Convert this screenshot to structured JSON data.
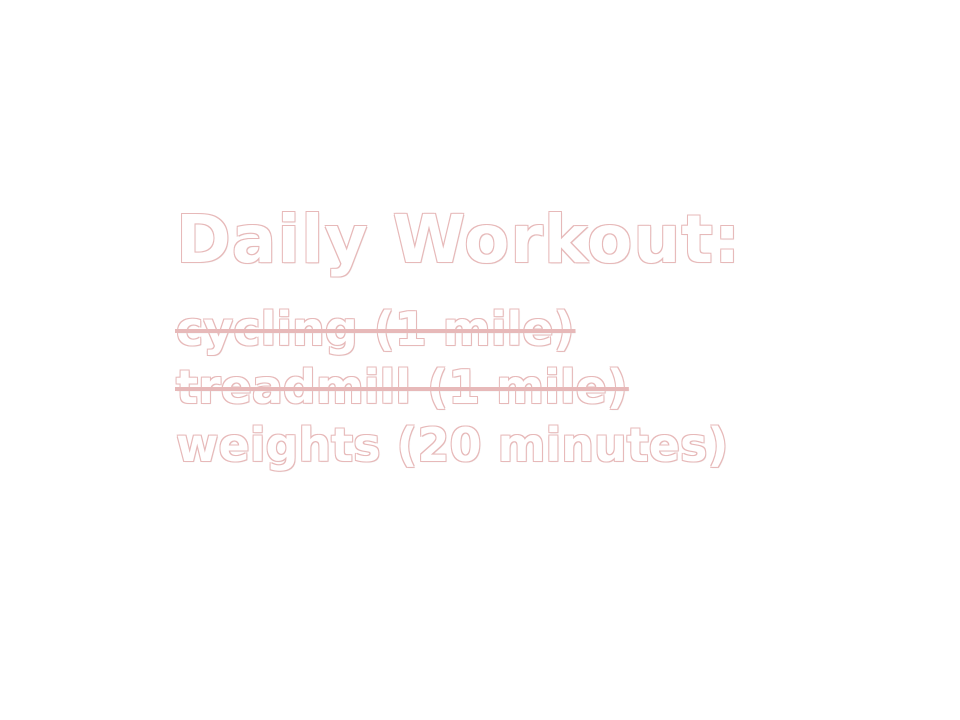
{
  "workout": {
    "title": "Daily Workout:",
    "items": [
      {
        "label": "cycling (1 mile)",
        "done": true
      },
      {
        "label": "treadmill (1 mile)",
        "done": true
      },
      {
        "label": "weights (20 minutes)",
        "done": false
      }
    ]
  },
  "colors": {
    "background": "#ffffff",
    "text_fill": "#ffffff",
    "text_outline": "#e7b9b9"
  }
}
